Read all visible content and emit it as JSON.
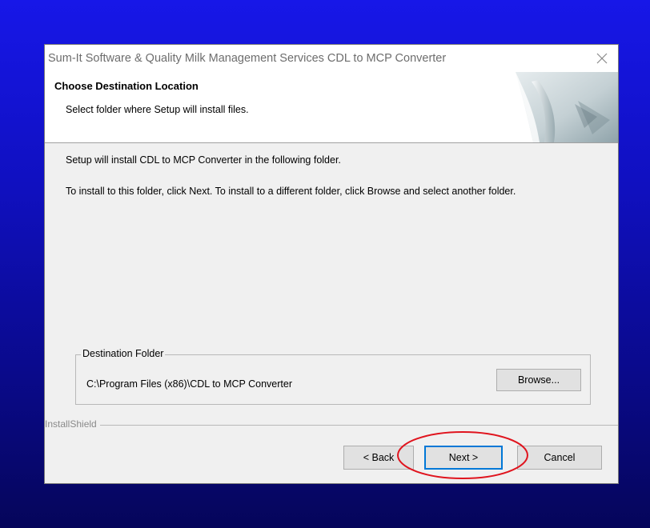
{
  "window": {
    "title": "Sum-It Software & Quality Milk Management Services CDL to MCP Converter"
  },
  "header": {
    "title": "Choose Destination Location",
    "subtitle": "Select folder where Setup will install files."
  },
  "body": {
    "line1": "Setup will install CDL to MCP Converter in the following folder.",
    "line2": "To install to this folder, click Next. To install to a different folder, click Browse and select another folder."
  },
  "destination": {
    "group_label": "Destination Folder",
    "path": "C:\\Program Files (x86)\\CDL to MCP Converter",
    "browse_label": "Browse..."
  },
  "footer": {
    "brand": "InstallShield",
    "back_label": "< Back",
    "next_label": "Next >",
    "cancel_label": "Cancel"
  },
  "icons": {
    "close": "close-icon",
    "header_graphic": "page-curl-graphic"
  },
  "colors": {
    "background_top": "#1717e8",
    "background_bottom": "#05055a",
    "dialog": "#f0f0f0",
    "focus_border": "#0078d7",
    "annotation": "#e0141e"
  }
}
